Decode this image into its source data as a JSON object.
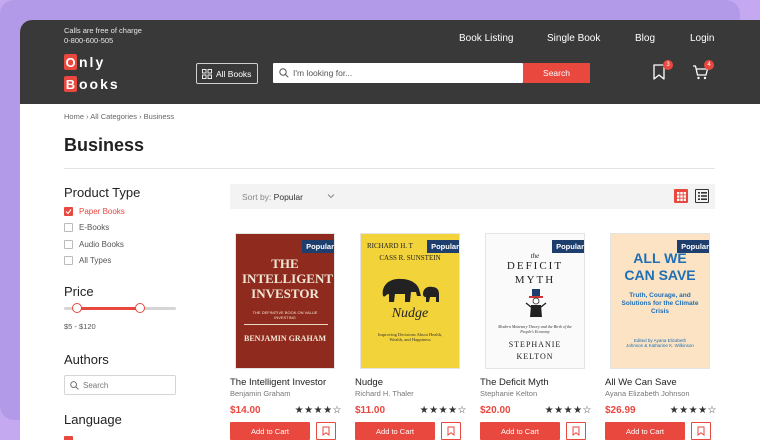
{
  "header": {
    "contact_line1": "Calls are free of charge",
    "contact_line2": "0-800-600-505",
    "nav": [
      "Book Listing",
      "Single Book",
      "Blog",
      "Login"
    ],
    "logo_line1_letter": "O",
    "logo_line1_rest": "nly",
    "logo_line2_letter": "B",
    "logo_line2_rest": "ooks",
    "all_books_label": "All Books",
    "search_placeholder": "I'm looking for...",
    "search_button": "Search",
    "wishlist_count": "3",
    "cart_count": "4"
  },
  "breadcrumb": [
    "Home",
    "All Categories",
    "Business"
  ],
  "page_title": "Business",
  "sidebar": {
    "product_type_heading": "Product Type",
    "product_types": [
      "Paper Books",
      "E-Books",
      "Audio Books",
      "All Types"
    ],
    "price_heading": "Price",
    "price_range": "$5 - $120",
    "price_slider": {
      "min_fraction": 0.12,
      "max_fraction": 0.68
    },
    "authors_heading": "Authors",
    "author_search_placeholder": "Search",
    "language_heading": "Language"
  },
  "sort": {
    "label": "Sort by:",
    "value": "Popular"
  },
  "products": [
    {
      "title": "The Intelligent Investor",
      "author": "Benjamin Graham",
      "price": "$14.00",
      "stars": "★★★★☆",
      "badge": "Popular",
      "button": "Add to Cart",
      "cover_title": "THE INTELLIGENT INVESTOR",
      "cover_sub": "THE DEFINITIVE BOOK ON VALUE INVESTING",
      "cover_author": "BENJAMIN GRAHAM"
    },
    {
      "title": "Nudge",
      "author": "Richard H. Thaler",
      "price": "$11.00",
      "stars": "★★★★☆",
      "badge": "Popular",
      "button": "Add to Cart",
      "cover_author1": "RICHARD H. T",
      "cover_author2": "CASS R. SUNSTEIN",
      "cover_title": "Nudge",
      "cover_sub": "Improving Decisions About Health, Wealth, and Happiness"
    },
    {
      "title": "The Deficit Myth",
      "author": "Stephanie Kelton",
      "price": "$20.00",
      "stars": "★★★★☆",
      "badge": "Popular",
      "button": "Add to Cart",
      "cover_the": "the",
      "cover_title1": "DEFICIT",
      "cover_title2": "MYTH",
      "cover_sub": "Modern Monetary Theory and the Birth of the People's Economy",
      "cover_author1": "STEPHANIE",
      "cover_author2": "KELTON"
    },
    {
      "title": "All We Can Save",
      "author": "Ayana Elizabeth Johnson",
      "price": "$26.99",
      "stars": "★★★★☆",
      "badge": "Popular",
      "button": "Add to Cart",
      "cover_title1": "ALL WE",
      "cover_title2": "CAN SAVE",
      "cover_sub": "Truth, Courage, and Solutions for the Climate Crisis",
      "cover_edited": "Edited by Ayana Elizabeth Johnson & Katharine K. Wilkinson"
    }
  ],
  "colors": {
    "accent": "#e9483f",
    "header_bg": "#393939",
    "badge_bg": "#1e3f6e",
    "frame": "#b39ae8"
  }
}
